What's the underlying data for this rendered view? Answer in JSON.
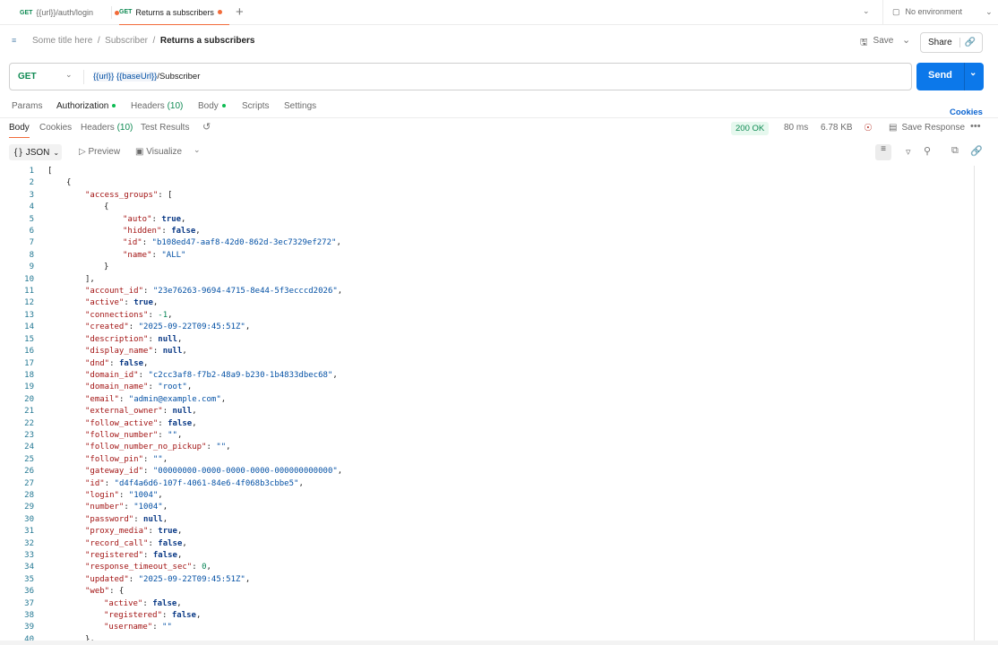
{
  "tabs": [
    {
      "method": "GET",
      "title": "{{url}}/auth/login"
    },
    {
      "method": "GET",
      "title": "Returns a subscribers"
    }
  ],
  "environment": "No environment",
  "breadcrumb": [
    "Some title here",
    "Subscriber",
    "Returns a subscribers"
  ],
  "header": {
    "save": "Save",
    "share": "Share"
  },
  "request": {
    "method": "GET",
    "url_vars": [
      "{{url}}",
      "{{baseUrl}}"
    ],
    "url_path": "/Subscriber",
    "send": "Send"
  },
  "request_tabs": [
    "Params",
    "Authorization",
    "Headers",
    "(10)",
    "Body",
    "Scripts",
    "Settings"
  ],
  "cookies_link": "Cookies",
  "response_tabs": [
    "Body",
    "Cookies",
    "Headers",
    "(10)",
    "Test Results"
  ],
  "status": {
    "code": "200 OK",
    "time": "80 ms",
    "size": "6.78 KB",
    "save_response": "Save Response"
  },
  "view": {
    "format": "JSON",
    "preview": "Preview",
    "visualize": "Visualize"
  },
  "colors": {
    "accent": "#0c78ea",
    "tab_underline": "#f26b3a",
    "status_ok": "#0f8a53"
  },
  "code_lines": [
    "[",
    "    {",
    "        \"access_groups\": [",
    "            {",
    "                \"auto\": true,",
    "                \"hidden\": false,",
    "                \"id\": \"b108ed47-aaf8-42d0-862d-3ec7329ef272\",",
    "                \"name\": \"ALL\"",
    "            }",
    "        ],",
    "        \"account_id\": \"23e76263-9694-4715-8e44-5f3ecccd2026\",",
    "        \"active\": true,",
    "        \"connections\": -1,",
    "        \"created\": \"2025-09-22T09:45:51Z\",",
    "        \"description\": null,",
    "        \"display_name\": null,",
    "        \"dnd\": false,",
    "        \"domain_id\": \"c2cc3af8-f7b2-48a9-b230-1b4833dbec68\",",
    "        \"domain_name\": \"root\",",
    "        \"email\": \"admin@example.com\",",
    "        \"external_owner\": null,",
    "        \"follow_active\": false,",
    "        \"follow_number\": \"\",",
    "        \"follow_number_no_pickup\": \"\",",
    "        \"follow_pin\": \"\",",
    "        \"gateway_id\": \"00000000-0000-0000-0000-000000000000\",",
    "        \"id\": \"d4f4a6d6-107f-4061-84e6-4f068b3cbbe5\",",
    "        \"login\": \"1004\",",
    "        \"number\": \"1004\",",
    "        \"password\": null,",
    "        \"proxy_media\": true,",
    "        \"record_call\": false,",
    "        \"registered\": false,",
    "        \"response_timeout_sec\": 0,",
    "        \"updated\": \"2025-09-22T09:45:51Z\",",
    "        \"web\": {",
    "            \"active\": false,",
    "            \"registered\": false,",
    "            \"username\": \"\"",
    "        },"
  ]
}
